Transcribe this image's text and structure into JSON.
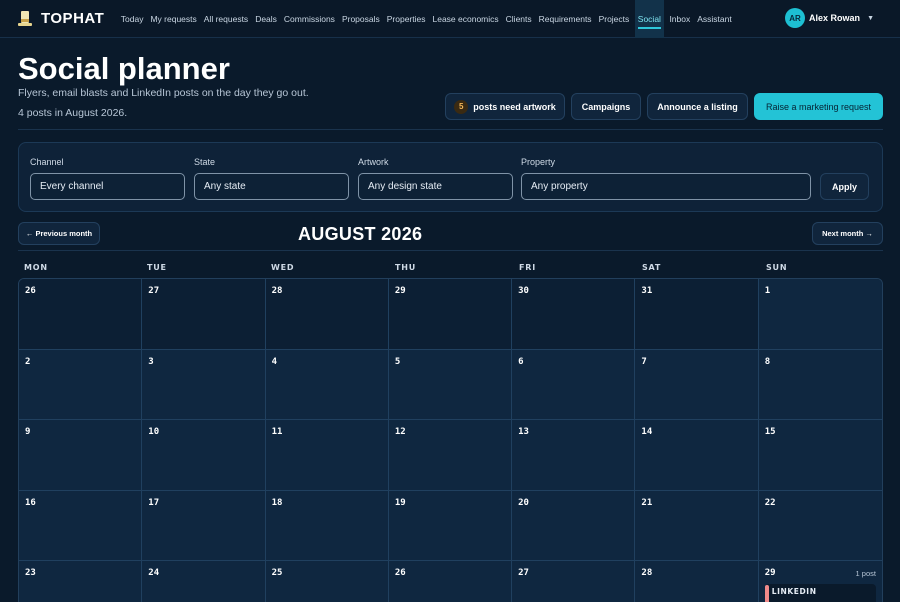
{
  "nav": {
    "brand": "TOPHAT",
    "links": [
      "Today",
      "My requests",
      "All requests",
      "Deals",
      "Commissions",
      "Proposals",
      "Properties",
      "Lease economics",
      "Clients",
      "Requirements",
      "Projects",
      "Social",
      "Inbox",
      "Assistant"
    ],
    "active": "Social",
    "user": {
      "initials": "AR",
      "name": "Alex Rowan"
    }
  },
  "header": {
    "title": "Social planner",
    "subtitle": "Flyers, email blasts and LinkedIn posts on the day they go out.",
    "count_line": "4 posts in August 2026.",
    "artwork_count": "5",
    "artwork_label": "posts need artwork",
    "campaigns_label": "Campaigns",
    "announce_label": "Announce a listing",
    "primary_label": "Raise a marketing request"
  },
  "filters": {
    "channel": {
      "label": "Channel",
      "value": "Every channel"
    },
    "state": {
      "label": "State",
      "value": "Any state"
    },
    "artwork": {
      "label": "Artwork",
      "value": "Any design state"
    },
    "property": {
      "label": "Property",
      "value": "Any property"
    },
    "apply_label": "Apply"
  },
  "calendar": {
    "prev_label": "← Previous month",
    "next_label": "Next month →",
    "month_title": "AUGUST 2026",
    "weekdays": [
      "MON",
      "TUE",
      "WED",
      "THU",
      "FRI",
      "SAT",
      "SUN"
    ],
    "weeks": [
      [
        {
          "d": "26",
          "m": true
        },
        {
          "d": "27",
          "m": true
        },
        {
          "d": "28",
          "m": true
        },
        {
          "d": "29",
          "m": true
        },
        {
          "d": "30",
          "m": true
        },
        {
          "d": "31",
          "m": true
        },
        {
          "d": "1"
        }
      ],
      [
        {
          "d": "2"
        },
        {
          "d": "3"
        },
        {
          "d": "4"
        },
        {
          "d": "5"
        },
        {
          "d": "6"
        },
        {
          "d": "7"
        },
        {
          "d": "8"
        }
      ],
      [
        {
          "d": "9"
        },
        {
          "d": "10"
        },
        {
          "d": "11"
        },
        {
          "d": "12"
        },
        {
          "d": "13"
        },
        {
          "d": "14"
        },
        {
          "d": "15"
        }
      ],
      [
        {
          "d": "16"
        },
        {
          "d": "17"
        },
        {
          "d": "18"
        },
        {
          "d": "19"
        },
        {
          "d": "20"
        },
        {
          "d": "21"
        },
        {
          "d": "22"
        }
      ],
      [
        {
          "d": "23"
        },
        {
          "d": "24"
        },
        {
          "d": "25"
        },
        {
          "d": "26"
        },
        {
          "d": "27"
        },
        {
          "d": "28"
        },
        {
          "d": "29",
          "count": "1 post",
          "channel": "LINKEDIN"
        }
      ]
    ]
  },
  "colors": {
    "background": "#0a1a2b",
    "accent": "#23c3d6",
    "linkedin_marker": "#ef8a8a",
    "badge": "#f5b85a"
  }
}
